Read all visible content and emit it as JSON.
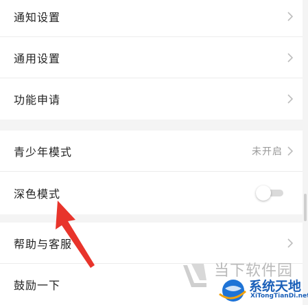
{
  "settings": {
    "group1": [
      {
        "label": "通知设置"
      },
      {
        "label": "通用设置"
      },
      {
        "label": "功能申请"
      }
    ],
    "group2": [
      {
        "label": "青少年模式",
        "value": "未开启"
      },
      {
        "label": "深色模式",
        "toggle": false
      }
    ],
    "group3": [
      {
        "label": "帮助与客服"
      },
      {
        "label": "鼓励一下"
      }
    ]
  },
  "watermark": {
    "site_cn": "当下软件园",
    "brand_cn": "系统天地",
    "brand_url": "XiTongTianDi.net"
  },
  "colors": {
    "background": "#f4f4f4",
    "row_bg": "#ffffff",
    "arrow": "#e8342b",
    "watermark_blue": "#1a5fb8"
  }
}
